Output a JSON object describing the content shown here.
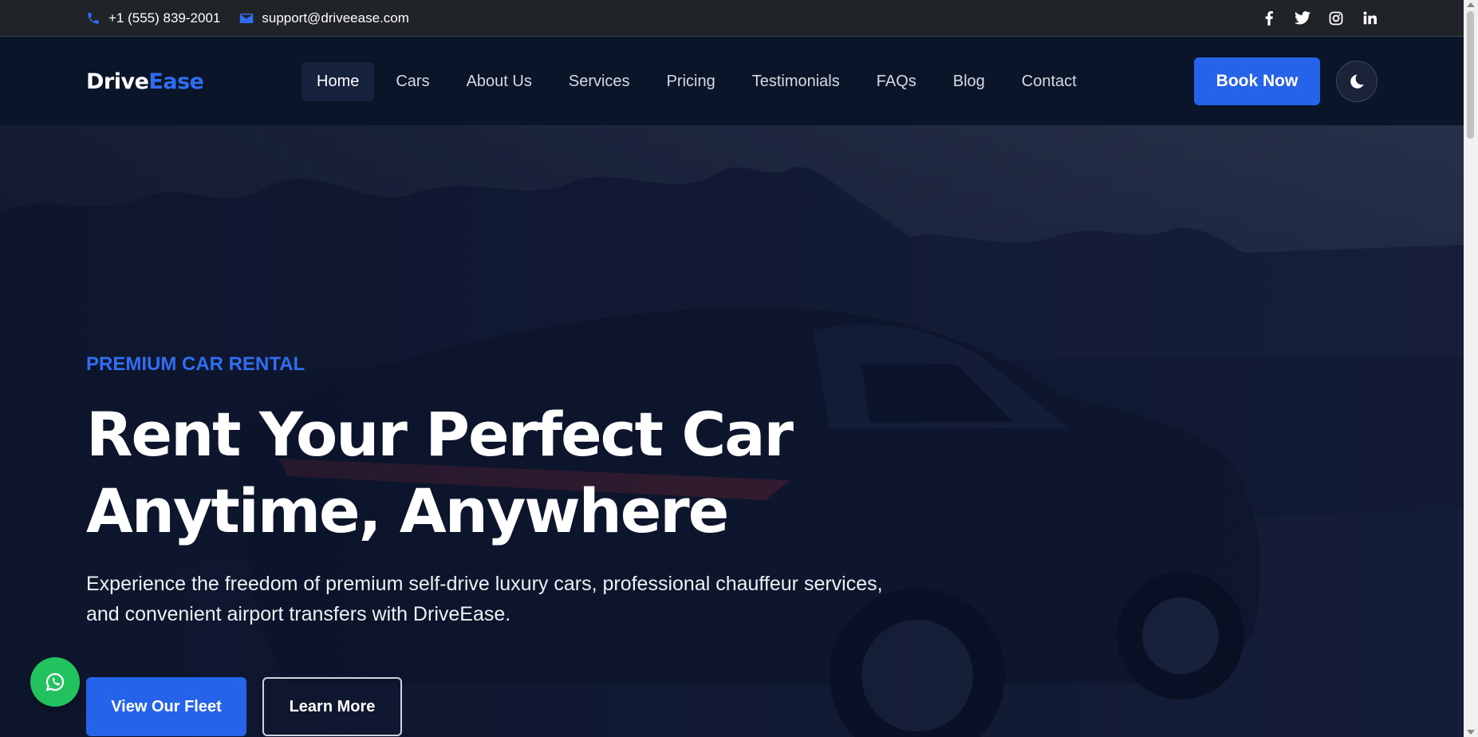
{
  "topbar": {
    "phone": "+1 (555) 839-2001",
    "email": "support@driveease.com",
    "socials": [
      "facebook-icon",
      "twitter-icon",
      "instagram-icon",
      "linkedin-icon"
    ]
  },
  "brand": {
    "part1": "Drive",
    "part2": "Ease",
    "accent": "#2f6df2"
  },
  "nav": {
    "items": [
      {
        "label": "Home",
        "active": true
      },
      {
        "label": "Cars"
      },
      {
        "label": "About Us"
      },
      {
        "label": "Services"
      },
      {
        "label": "Pricing"
      },
      {
        "label": "Testimonials"
      },
      {
        "label": "FAQs"
      },
      {
        "label": "Blog"
      },
      {
        "label": "Contact"
      }
    ],
    "book_label": "Book Now",
    "theme_icon": "moon-icon"
  },
  "hero": {
    "eyebrow": "PREMIUM CAR RENTAL",
    "headline_line1": "Rent Your Perfect Car",
    "headline_line2": "Anytime, Anywhere",
    "lead_line1": "Experience the freedom of premium self-drive luxury cars, professional chauffeur services,",
    "lead_line2": "and convenient airport transfers with DriveEase.",
    "primary_cta": "View Our Fleet",
    "secondary_cta": "Learn More"
  },
  "floating": {
    "whatsapp_icon": "whatsapp-icon"
  },
  "colors": {
    "primary": "#2563eb",
    "topbar_bg": "#202328",
    "nav_bg": "#0b1529",
    "whatsapp": "#22c35e"
  }
}
